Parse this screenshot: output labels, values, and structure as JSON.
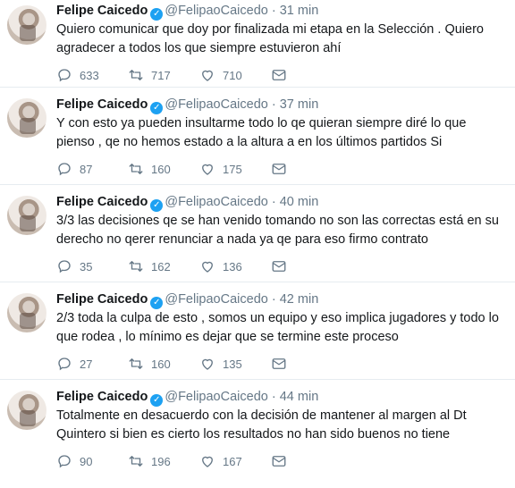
{
  "tweets": [
    {
      "name": "Felipe Caicedo",
      "handle": "@FelipaoCaicedo",
      "time": "31 min",
      "text": "Quiero comunicar que doy por finalizada mi etapa en la Selección . Quiero agradecer a todos los que siempre estuvieron ahí",
      "replies": "633",
      "retweets": "717",
      "likes": "710"
    },
    {
      "name": "Felipe Caicedo",
      "handle": "@FelipaoCaicedo",
      "time": "37 min",
      "text": "Y con esto ya pueden insultarme todo lo qe quieran siempre diré lo que pienso , qe no hemos estado a la altura a en los últimos partidos Si",
      "replies": "87",
      "retweets": "160",
      "likes": "175"
    },
    {
      "name": "Felipe Caicedo",
      "handle": "@FelipaoCaicedo",
      "time": "40 min",
      "text": "3/3 las decisiones qe se han venido tomando no son las correctas está en su derecho no qerer renunciar a nada ya qe para eso firmo contrato",
      "replies": "35",
      "retweets": "162",
      "likes": "136"
    },
    {
      "name": "Felipe Caicedo",
      "handle": "@FelipaoCaicedo",
      "time": "42 min",
      "text": "2/3 toda la culpa de esto , somos un equipo y eso implica jugadores y todo lo que rodea , lo mínimo es dejar que se termine este proceso",
      "replies": "27",
      "retweets": "160",
      "likes": "135"
    },
    {
      "name": "Felipe Caicedo",
      "handle": "@FelipaoCaicedo",
      "time": "44 min",
      "text": "Totalmente en desacuerdo con la decisión de mantener al margen al Dt Quintero si bien es cierto los resultados no han sido buenos no tiene",
      "replies": "90",
      "retweets": "196",
      "likes": "167"
    }
  ],
  "ui": {
    "separator": "·",
    "verified_glyph": "✓",
    "icons": [
      "reply-icon",
      "retweet-icon",
      "like-icon",
      "direct-message-icon",
      "verified-badge-icon"
    ]
  }
}
